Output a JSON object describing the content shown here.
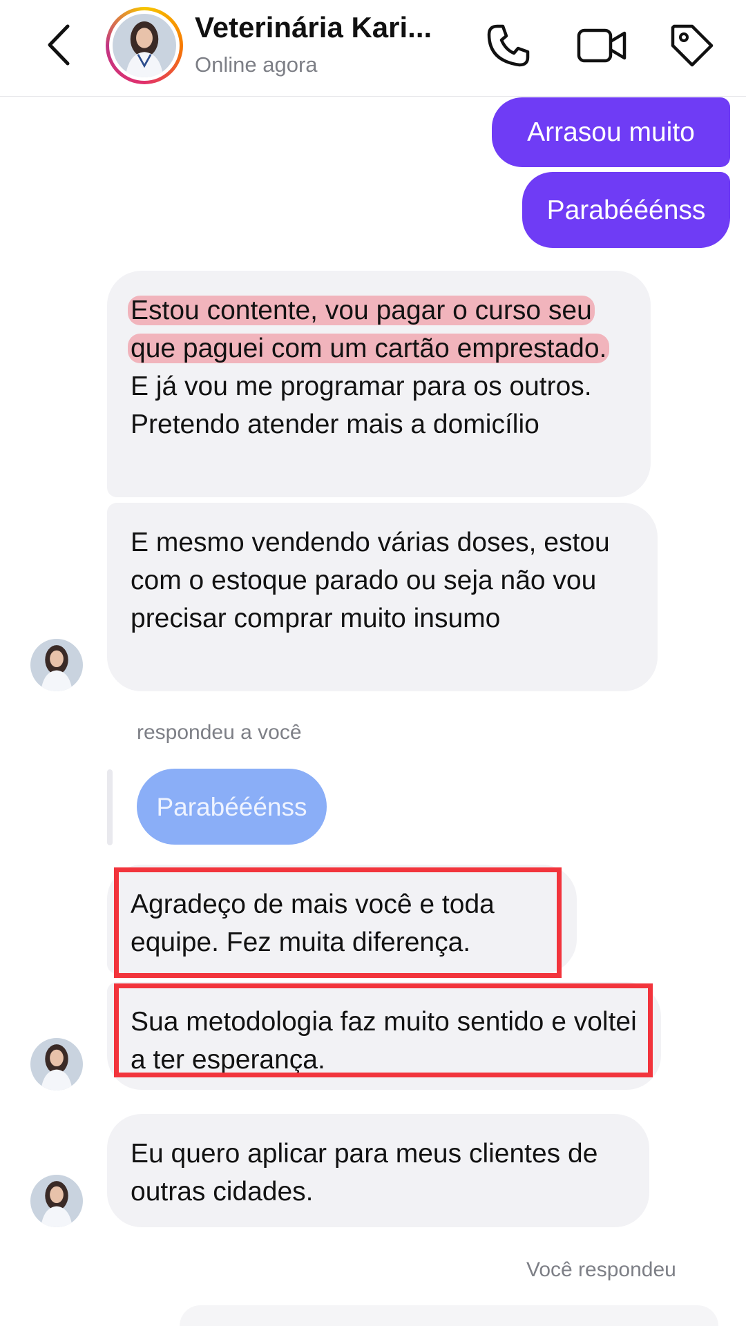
{
  "header": {
    "contact_name": "Veterinária Kari...",
    "status": "Online agora",
    "icons": [
      "back-icon",
      "phone-icon",
      "video-icon",
      "tag-icon"
    ]
  },
  "messages": {
    "out_1": "Arrasou muito",
    "out_2": "Parabééénss",
    "in_1_highlighted": "Estou contente, vou pagar o curso seu que paguei com um cartão emprestado.",
    "in_1_rest": " E já vou me programar para os outros. Pretendo atender mais a domicílio",
    "in_2": "E mesmo vendendo várias doses, estou com o estoque parado ou seja não vou precisar comprar muito insumo",
    "reply_label": "respondeu a você",
    "reply_quote": "Parabééénss",
    "in_3": "Agradeço de mais você e toda equipe. Fez muita diferença.",
    "in_4": "Sua metodologia faz muito sentido e voltei a ter esperança.",
    "in_5": "Eu quero aplicar para meus clientes de outras cidades.",
    "you_replied": "Você respondeu"
  },
  "colors": {
    "outgoing_bubble": "#6f3cf5",
    "incoming_bubble": "#f2f2f5",
    "reply_bubble": "#8aaef7",
    "highlight": "#f0828c",
    "annotation_box": "#f2343c"
  }
}
